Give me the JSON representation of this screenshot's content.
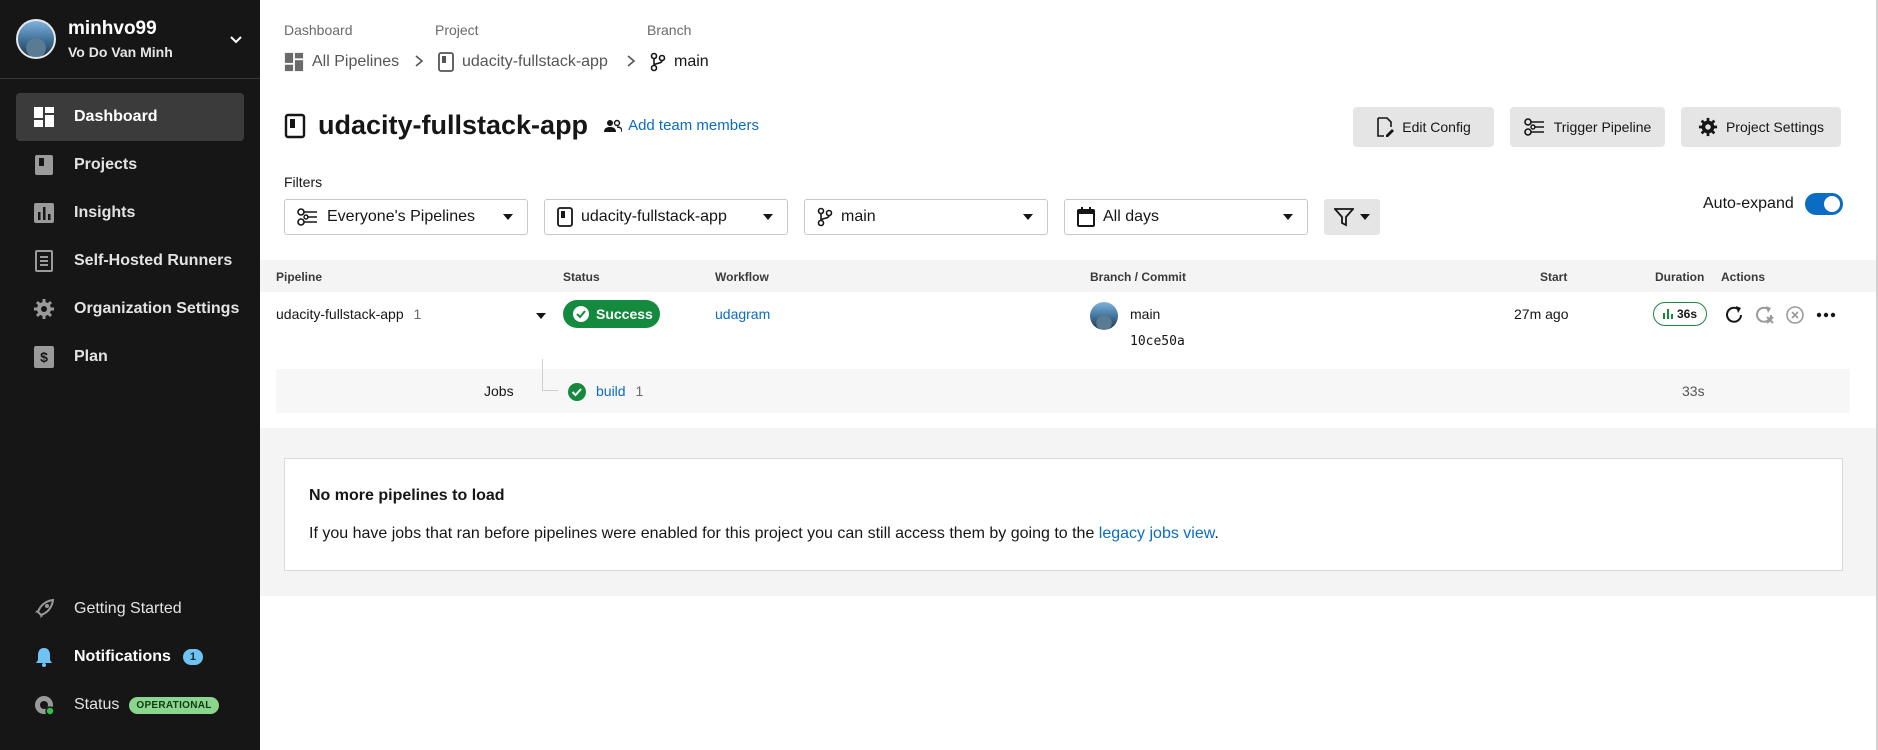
{
  "user": {
    "username": "minhvo99",
    "full_name": "Vo Do Van Minh"
  },
  "sidebar": {
    "items": [
      {
        "label": "Dashboard",
        "icon": "dashboard-icon",
        "active": true
      },
      {
        "label": "Projects",
        "icon": "projects-icon"
      },
      {
        "label": "Insights",
        "icon": "insights-icon"
      },
      {
        "label": "Self-Hosted Runners",
        "icon": "runners-icon"
      },
      {
        "label": "Organization Settings",
        "icon": "gear-icon"
      },
      {
        "label": "Plan",
        "icon": "dollar-icon"
      }
    ],
    "bottom": {
      "getting_started": "Getting Started",
      "notifications": "Notifications",
      "notifications_count": "1",
      "status": "Status",
      "status_badge": "OPERATIONAL"
    }
  },
  "breadcrumb": {
    "dashboard_label": "Dashboard",
    "dashboard_value": "All Pipelines",
    "project_label": "Project",
    "project_value": "udacity-fullstack-app",
    "branch_label": "Branch",
    "branch_value": "main"
  },
  "header": {
    "title": "udacity-fullstack-app",
    "add_team": "Add team members",
    "edit_config": "Edit Config",
    "trigger_pipeline": "Trigger Pipeline",
    "project_settings": "Project Settings"
  },
  "filters": {
    "label": "Filters",
    "pipelines": "Everyone's Pipelines",
    "project": "udacity-fullstack-app",
    "branch": "main",
    "days": "All days",
    "auto_expand": "Auto-expand",
    "auto_expand_on": true
  },
  "table": {
    "headers": {
      "pipeline": "Pipeline",
      "status": "Status",
      "workflow": "Workflow",
      "branch_commit": "Branch / Commit",
      "start": "Start",
      "duration": "Duration",
      "actions": "Actions"
    },
    "row": {
      "pipeline": "udacity-fullstack-app",
      "number": "1",
      "status": "Success",
      "workflow": "udagram",
      "branch": "main",
      "commit": "10ce50a",
      "start": "27m ago",
      "duration": "36s"
    },
    "jobs": {
      "label": "Jobs",
      "name": "build",
      "number": "1",
      "duration": "33s"
    }
  },
  "footer_card": {
    "title": "No more pipelines to load",
    "text": "If you have jobs that ran before pipelines were enabled for this project you can still access them by going to the ",
    "link": "legacy jobs view",
    "period": "."
  },
  "colors": {
    "sidebar_bg": "#161616",
    "accent_blue": "#0a6cc2",
    "success_green": "#138a3e"
  }
}
